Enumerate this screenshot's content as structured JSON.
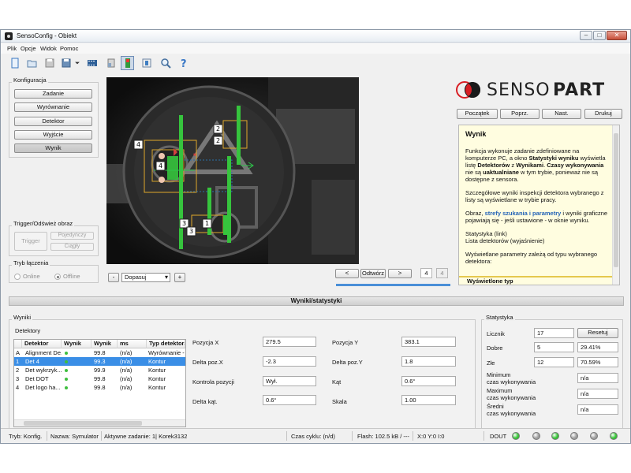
{
  "window": {
    "title": "SensoConfig - Obiekt",
    "controls": [
      "–",
      "□",
      "✕"
    ]
  },
  "menu": [
    "Plik",
    "Opcje",
    "Widok",
    "Pomoc"
  ],
  "toolbar_icons": [
    "new-file-icon",
    "open-folder-icon",
    "save-icon",
    "save-as-icon",
    "film-icon",
    "camera-upload-icon",
    "sensor-mode-icon",
    "settings-icon",
    "zoom-icon",
    "help-icon"
  ],
  "logo": {
    "brand_left": "SENSO",
    "brand_right": "PART"
  },
  "config": {
    "title": "Konfiguracja",
    "buttons": [
      "Zadanie",
      "Wyrównanie",
      "Detektor",
      "Wyjście",
      "Wynik"
    ]
  },
  "trigger": {
    "title": "Trigger/Odśwież obraz",
    "trigger_btn": "Trigger",
    "single_btn": "Pojedyńczy",
    "continuous_btn": "Ciągły"
  },
  "connection": {
    "title": "Tryb łączenia",
    "online": "Online",
    "offline": "Offline"
  },
  "image_controls": {
    "minus": "-",
    "fit": "Dopasuj",
    "plus": "+",
    "prev": "<",
    "play": "Odtwórz",
    "next": ">",
    "page": "4",
    "total": "4",
    "progress_percent": 100
  },
  "camera_labels": [
    "4",
    "4",
    "2",
    "2",
    "3",
    "1",
    "3"
  ],
  "help_nav": [
    "Początek",
    "Poprz.",
    "Nast.",
    "Drukuj"
  ],
  "help": {
    "title": "Wynik",
    "p1a": "Funkcja wykonuje zadanie zdefiniowane na komputerze PC, a okno ",
    "p1b": "Statystyki wyniku",
    "p1c": " wyświetla listę ",
    "p1d": "Detektorów",
    "p1e": " z ",
    "p1f": "Wynikami",
    "p1g": ". ",
    "p1h": "Czasy wykonywania",
    "p1i": " nie są ",
    "p1j": "uaktualniane",
    "p1k": " w tym trybie, ponieważ nie są dostępne z sensora.",
    "p2": "Szczegółowe wyniki inspekcji detektora wybranego z listy są wyświetlane w trybie pracy.",
    "p3a": "Obraz, ",
    "p3b": "strefy szukania i parametry",
    "p3c": " i wyniki graficzne pojawiają się - jeśli ustawione - w oknie wyniku.",
    "p4a": "Statystyka (link)",
    "p4b": "Lista detektorów (wyjaśnienie)",
    "p5": "Wyświetlane parametry zależą od typu wybranego detektora:",
    "footer": "Wyświetlone  typ"
  },
  "section_title": "Wyniki/statystyki",
  "results": {
    "group": "Wyniki",
    "detectors_label": "Detektory",
    "columns": [
      "",
      "Detektor",
      "Wynik",
      "Wynik",
      "ms",
      "Typ detektora"
    ],
    "rows": [
      {
        "id": "A",
        "name": "Alignment De...",
        "ok": true,
        "value": "99.8",
        "ms": "(n/a)",
        "type": "Wyrównanie - d"
      },
      {
        "id": "1",
        "name": "Det 4",
        "ok": true,
        "value": "99.3",
        "ms": "(n/a)",
        "type": "Kontur"
      },
      {
        "id": "2",
        "name": "Det wykrzyk...",
        "ok": true,
        "value": "99.9",
        "ms": "(n/a)",
        "type": "Kontur"
      },
      {
        "id": "3",
        "name": "Det DOT",
        "ok": true,
        "value": "99.8",
        "ms": "(n/a)",
        "type": "Kontur"
      },
      {
        "id": "4",
        "name": "Det logo ha...",
        "ok": true,
        "value": "99.8",
        "ms": "(n/a)",
        "type": "Kontur"
      }
    ]
  },
  "params": {
    "pos_x_label": "Pozycja X",
    "pos_x": "279.5",
    "pos_y_label": "Pozycja Y",
    "pos_y": "383.1",
    "dx_label": "Delta poz.X",
    "dx": "-2.3",
    "dy_label": "Delta poz.Y",
    "dy": "1.8",
    "ctrl_label": "Kontrola pozycji",
    "ctrl": "Wył.",
    "angle_label": "Kąt",
    "angle": "0.6°",
    "dangle_label": "Delta kąt.",
    "dangle": "0.6°",
    "scale_label": "Skala",
    "scale": "1.00"
  },
  "stats": {
    "group": "Statystyka",
    "counter_label": "Licznik",
    "counter": "17",
    "reset": "Resetuj",
    "good_label": "Dobre",
    "good": "5",
    "good_pct": "29.41%",
    "bad_label": "Złe",
    "bad": "12",
    "bad_pct": "70.59%",
    "min_label1": "Minimum",
    "min_label2": "czas wykonywania",
    "min": "n/a",
    "max_label1": "Maximum",
    "max_label2": "czas wykonywania",
    "max": "n/a",
    "avg_label1": "Średni",
    "avg_label2": "czas wykonywania",
    "avg": "n/a"
  },
  "status": {
    "mode_label": "Tryb:",
    "mode": "Konfig.",
    "name_label": "Nazwa:",
    "name": "Symulator",
    "task_label": "Aktywne zadanie:",
    "task": "1| Korek3132",
    "cycle_label": "Czas cyklu:",
    "cycle": "(n/d)",
    "flash_label": "Flash:",
    "flash": "102.5 kB / ---",
    "coords": "X:0 Y:0 I:0",
    "dout": "DOUT",
    "leds": [
      "#35c435",
      "#9e9e9e",
      "#35c435",
      "#9e9e9e",
      "#9e9e9e",
      "#35c435"
    ]
  }
}
